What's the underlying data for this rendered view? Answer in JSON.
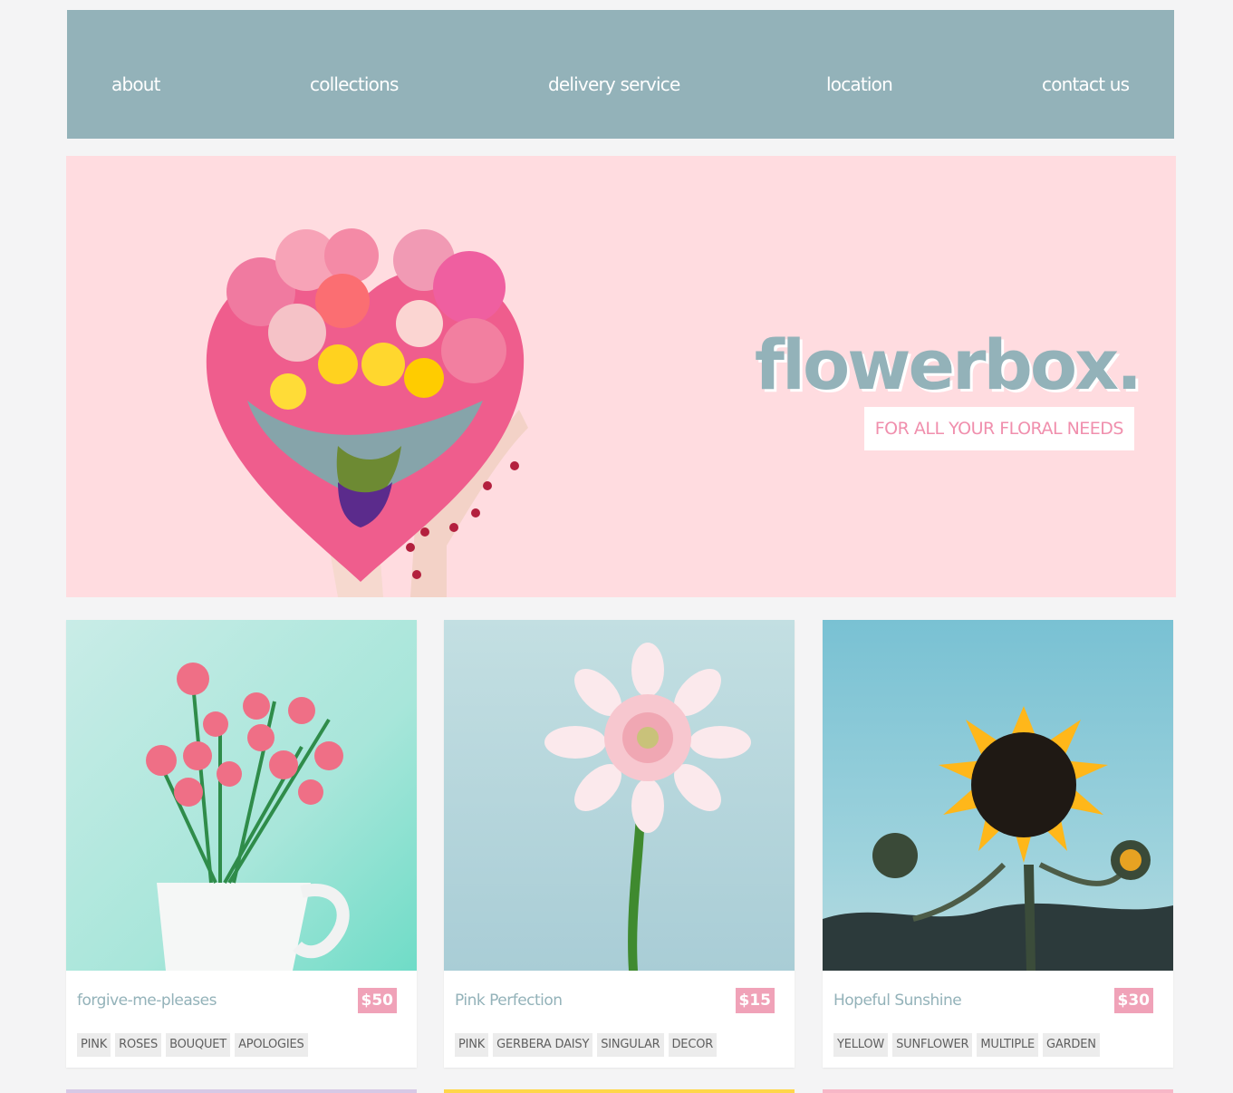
{
  "nav": {
    "items": [
      "about",
      "collections",
      "delivery service",
      "location",
      "contact us"
    ]
  },
  "hero": {
    "brand": "flowerbox.",
    "tagline": "FOR ALL YOUR FLORAL NEEDS"
  },
  "products": [
    {
      "title": "forgive-me-pleases",
      "price": "$50",
      "tags": [
        "PINK",
        "ROSES",
        "BOUQUET",
        "APOLOGIES"
      ],
      "image": "pink-roses-in-pitcher"
    },
    {
      "title": "Pink Perfection",
      "price": "$15",
      "tags": [
        "PINK",
        "GERBERA DAISY",
        "SINGULAR",
        "DECOR"
      ],
      "image": "pink-gerbera-daisy"
    },
    {
      "title": "Hopeful Sunshine",
      "price": "$30",
      "tags": [
        "YELLOW",
        "SUNFLOWER",
        "MULTIPLE",
        "GARDEN"
      ],
      "image": "sunflower-sky"
    }
  ],
  "colors": {
    "nav": "#93b2b9",
    "hero": "#ffdce0",
    "price": "#f0a2b8",
    "accent_pink": "#f08fad"
  }
}
